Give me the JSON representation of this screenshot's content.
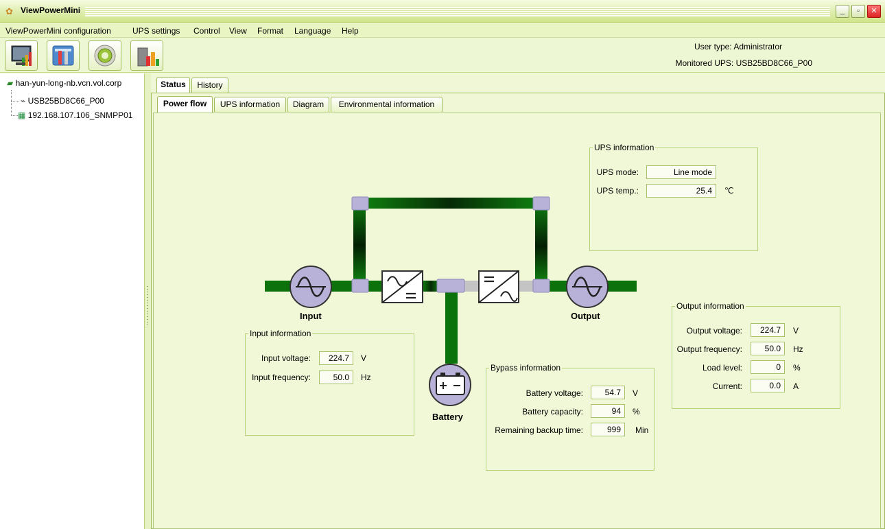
{
  "window": {
    "title": "ViewPowerMini"
  },
  "menu": [
    "ViewPowerMini  configuration",
    "UPS settings",
    "Control",
    "View",
    "Format",
    "Language",
    "Help"
  ],
  "toolbar": {
    "buttons": [
      "monitor-chart-icon",
      "settings-tools-icon",
      "power-disc-icon",
      "building-chart-icon"
    ],
    "user_type_label": "User type:",
    "user_type_value": "Administrator",
    "monitored_label": "Monitored UPS:",
    "monitored_value": "USB25BD8C66_P00"
  },
  "tree": {
    "root": "han-yun-long-nb.vcn.vol.corp",
    "children": [
      "USB25BD8C66_P00",
      "192.168.107.106_SNMPP01"
    ]
  },
  "tabs": {
    "main": [
      "Status",
      "History"
    ],
    "sub": [
      "Power flow",
      "UPS information",
      "Diagram",
      "Environmental information"
    ]
  },
  "diagram": {
    "input_label": "Input",
    "output_label": "Output",
    "battery_label": "Battery"
  },
  "ups_info": {
    "title": "UPS information",
    "mode_label": "UPS mode:",
    "mode_value": "Line mode",
    "temp_label": "UPS temp.:",
    "temp_value": "25.4",
    "temp_unit": "℃"
  },
  "input_info": {
    "title": "Input information",
    "voltage_label": "Input voltage:",
    "voltage_value": "224.7",
    "voltage_unit": "V",
    "freq_label": "Input frequency:",
    "freq_value": "50.0",
    "freq_unit": "Hz"
  },
  "bypass_info": {
    "title": "Bypass information",
    "bat_voltage_label": "Battery voltage:",
    "bat_voltage_value": "54.7",
    "bat_voltage_unit": "V",
    "bat_capacity_label": "Battery capacity:",
    "bat_capacity_value": "94",
    "bat_capacity_unit": "%",
    "backup_label": "Remaining backup time:",
    "backup_value": "999",
    "backup_unit": "Min"
  },
  "output_info": {
    "title": "Output information",
    "voltage_label": "Output voltage:",
    "voltage_value": "224.7",
    "voltage_unit": "V",
    "freq_label": "Output frequency:",
    "freq_value": "50.0",
    "freq_unit": "Hz",
    "load_label": "Load level:",
    "load_value": "0",
    "load_unit": "%",
    "current_label": "Current:",
    "current_value": "0.0",
    "current_unit": "A"
  }
}
